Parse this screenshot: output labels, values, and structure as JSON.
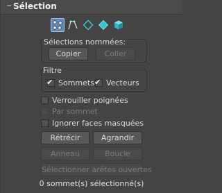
{
  "rollout": {
    "toggle": "−",
    "title": "Sélection"
  },
  "mode_icons": [
    {
      "icon": "vertex-icon",
      "active": true
    },
    {
      "icon": "edge-icon",
      "active": false
    },
    {
      "icon": "border-icon",
      "active": false
    },
    {
      "icon": "polygon-icon",
      "active": false
    },
    {
      "icon": "element-icon",
      "active": false
    }
  ],
  "named_selections": {
    "label": "Sélections nommées:",
    "copy": "Copier",
    "paste": "Coller"
  },
  "filter": {
    "label": "Filtre",
    "vertices": {
      "label": "Sommets",
      "checked": true
    },
    "vectors": {
      "label": "Vecteurs",
      "checked": true
    }
  },
  "options": {
    "lock_handles": {
      "label": "Verrouiller poignées",
      "checked": false
    },
    "by_vertex": {
      "label": "Par sommet",
      "checked": false,
      "disabled": true
    },
    "ignore_backfacing": {
      "label": "Ignorer faces masquées",
      "checked": false
    }
  },
  "actions": {
    "shrink": "Rétrécir",
    "grow": "Agrandir",
    "ring": "Anneau",
    "loop": "Boucle",
    "select_open_edges": "Sélectionner arêtes ouvertes"
  },
  "status": "0 sommet(s) sélectionné(s)",
  "colors": {
    "panel_bg": "#444444",
    "active_mode_bg": "#5f86b4",
    "icon_cyan": "#35c6d6",
    "disabled_text": "#7b7b7b"
  }
}
